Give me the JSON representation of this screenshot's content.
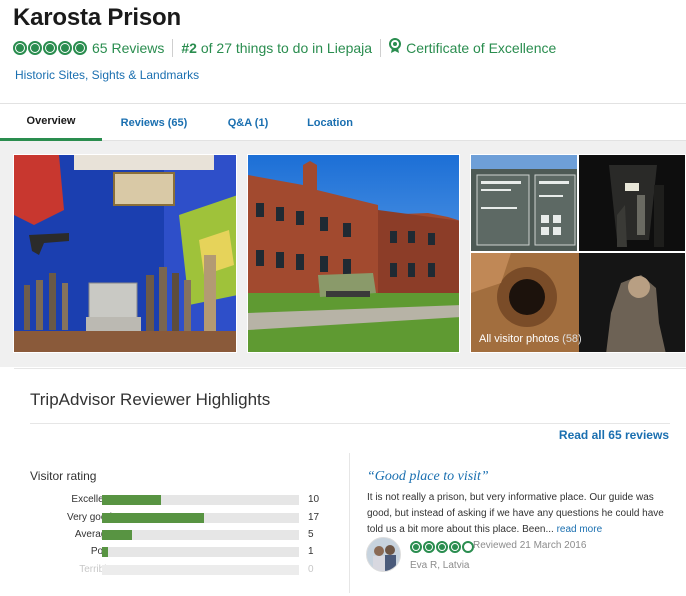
{
  "attraction": {
    "title": "Karosta Prison",
    "rating_bubbles": [
      1,
      1,
      1,
      1,
      1
    ],
    "reviews_count": "65 Reviews",
    "rank_prefix": "#2",
    "rank_suffix": " of 27 things to do in Liepaja",
    "certificate": "Certificate of Excellence",
    "category": "Historic Sites, Sights & Landmarks"
  },
  "tabs": [
    {
      "label": "Overview",
      "active": true
    },
    {
      "label": "Reviews (65)",
      "active": false
    },
    {
      "label": "Q&A (1)",
      "active": false
    },
    {
      "label": "Location",
      "active": false
    }
  ],
  "gallery": {
    "all_photos_label": "All visitor photos",
    "all_photos_count": "(58)"
  },
  "highlights": {
    "title": "TripAdvisor Reviewer Highlights",
    "read_all": "Read all 65 reviews",
    "visitor_rating_title": "Visitor rating",
    "ratings": [
      {
        "label": "Excellent",
        "count": 10,
        "fraction": 0.3,
        "muted": false
      },
      {
        "label": "Very good",
        "count": 17,
        "fraction": 0.52,
        "muted": false
      },
      {
        "label": "Average",
        "count": 5,
        "fraction": 0.15,
        "muted": false
      },
      {
        "label": "Poor",
        "count": 1,
        "fraction": 0.03,
        "muted": false
      },
      {
        "label": "Terrible",
        "count": 0,
        "fraction": 0.0,
        "muted": true
      }
    ],
    "review": {
      "quote": "“Good place to visit”",
      "text": "It is not really a prison, but very informative place. Our guide was good, but instead of asking if we have any questions he could have told us a bit more about this place. Been...",
      "read_more": "read more",
      "bubbles": [
        1,
        1,
        1,
        1,
        0
      ],
      "date": "Reviewed 21 March 2016",
      "reviewer": "Eva R, Latvia"
    }
  },
  "colors": {
    "brand_green": "#2a8d4f",
    "bar_green": "#589442",
    "link_blue": "#1a6fb0"
  }
}
